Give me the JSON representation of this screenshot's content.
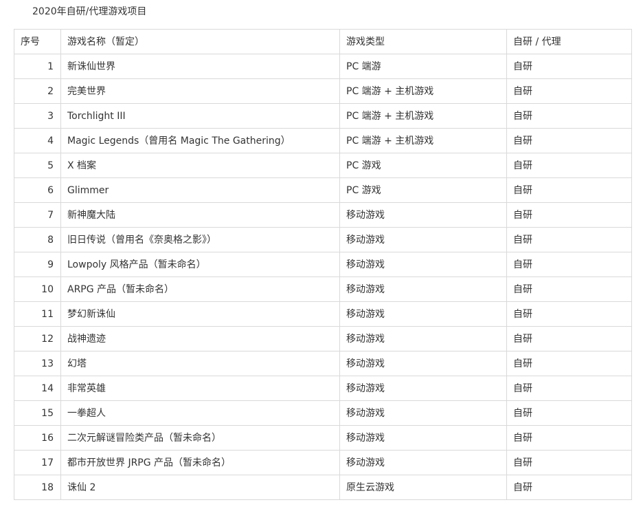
{
  "caption": "2020年自研/代理游戏项目",
  "table": {
    "headers": [
      "序号",
      "游戏名称（暂定）",
      "游戏类型",
      "自研 / 代理"
    ],
    "rows": [
      [
        "1",
        "新诛仙世界",
        "PC 端游",
        "自研"
      ],
      [
        "2",
        "完美世界",
        "PC 端游 + 主机游戏",
        "自研"
      ],
      [
        "3",
        "Torchlight III",
        "PC 端游 + 主机游戏",
        "自研"
      ],
      [
        "4",
        "Magic Legends（曾用名 Magic The Gathering）",
        "PC 端游 + 主机游戏",
        "自研"
      ],
      [
        "5",
        "X 档案",
        "PC 游戏",
        "自研"
      ],
      [
        "6",
        "Glimmer",
        "PC 游戏",
        "自研"
      ],
      [
        "7",
        "新神魔大陆",
        "移动游戏",
        "自研"
      ],
      [
        "8",
        "旧日传说（曾用名《奈奥格之影》）",
        "移动游戏",
        "自研"
      ],
      [
        "9",
        "Lowpoly 风格产品（暂未命名）",
        "移动游戏",
        "自研"
      ],
      [
        "10",
        "ARPG 产品（暂未命名）",
        "移动游戏",
        "自研"
      ],
      [
        "11",
        "梦幻新诛仙",
        "移动游戏",
        "自研"
      ],
      [
        "12",
        "战神遗迹",
        "移动游戏",
        "自研"
      ],
      [
        "13",
        "幻塔",
        "移动游戏",
        "自研"
      ],
      [
        "14",
        "非常英雄",
        "移动游戏",
        "自研"
      ],
      [
        "15",
        "一拳超人",
        "移动游戏",
        "自研"
      ],
      [
        "16",
        "二次元解谜冒险类产品（暂未命名）",
        "移动游戏",
        "自研"
      ],
      [
        "17",
        "都市开放世界 JRPG 产品（暂未命名）",
        "移动游戏",
        "自研"
      ],
      [
        "18",
        "诛仙 2",
        "原生云游戏",
        "自研"
      ]
    ]
  }
}
